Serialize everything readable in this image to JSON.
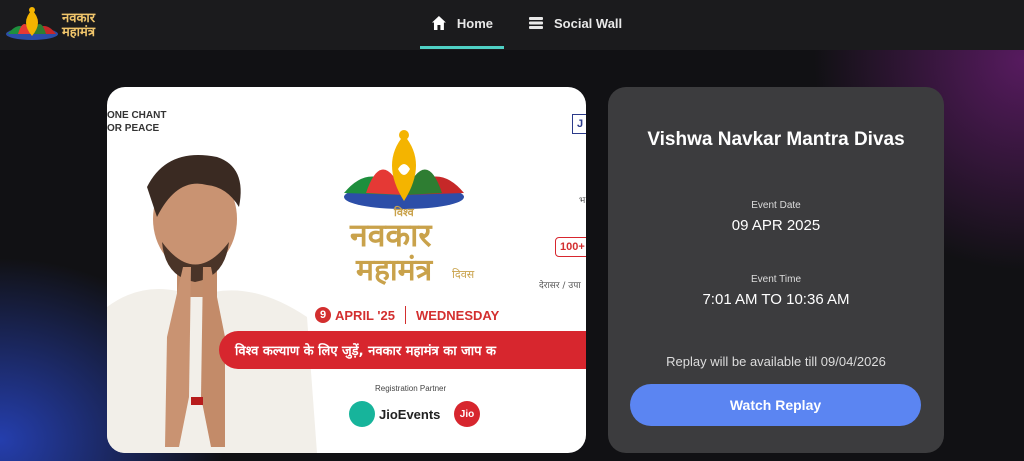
{
  "brand": {
    "logo_text_line1": "नवकार",
    "logo_text_line2": "महामंत्र"
  },
  "nav": {
    "home_label": "Home",
    "social_label": "Social Wall"
  },
  "banner": {
    "chant_line1": "ONE CHANT",
    "chant_line2": "OR PEACE",
    "vishwa": "विश्व",
    "title_line1": "नवकार",
    "title_line2": "महामंत्र",
    "divas": "दिवस",
    "date_num": "9",
    "date_text": "APRIL '25",
    "weekday": "WEDNESDAY",
    "tagline": "विश्व कल्याण के लिए जुड़ें, नवकार महामंत्र का जाप क",
    "registration_partner": "Registration Partner",
    "jioevents": "JioEvents",
    "jio": "Jio",
    "edge_j": "J",
    "edge_100": "100+",
    "edge_bh": "भ",
    "edge_derasar": "देरासर / उपा"
  },
  "event": {
    "title": "Vishwa Navkar Mantra Divas",
    "date_label": "Event Date",
    "date_value": "09 APR 2025",
    "time_label": "Event Time",
    "time_value": "7:01 AM TO 10:36 AM",
    "replay_note": "Replay will be available till 09/04/2026",
    "watch_button": "Watch Replay"
  },
  "colors": {
    "accent_tab": "#4fd1c5",
    "button": "#5b85f2",
    "card": "#3c3c3e",
    "brand_red": "#d7262e"
  },
  "icons": {
    "home": "home-icon",
    "social": "social-wall-icon"
  }
}
